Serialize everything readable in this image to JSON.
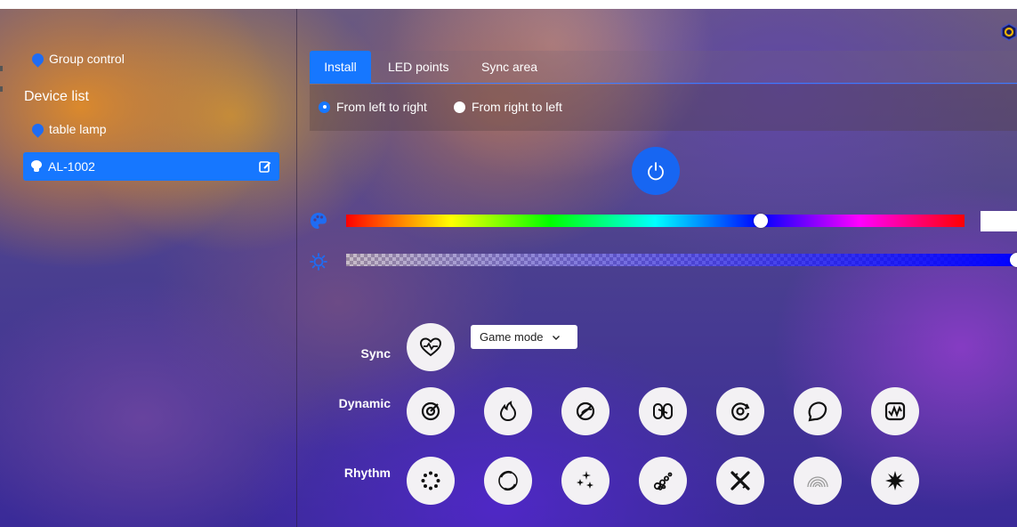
{
  "sidebar": {
    "group_control": "Group control",
    "device_list_title": "Device list",
    "devices": [
      {
        "name": "table lamp",
        "selected": false
      },
      {
        "name": "AL-1002",
        "selected": true
      }
    ]
  },
  "tabs": [
    {
      "label": "Install",
      "active": true
    },
    {
      "label": "LED points",
      "active": false
    },
    {
      "label": "Sync area",
      "active": false
    }
  ],
  "direction": {
    "options": [
      {
        "label": "From left to right",
        "checked": true
      },
      {
        "label": "From right to left",
        "checked": false
      }
    ]
  },
  "color_slider": {
    "hue_fraction": 0.67,
    "swatch_color": "#ffffff"
  },
  "brightness_slider": {
    "level_fraction": 1.0,
    "color": "#0000ff"
  },
  "modes": {
    "sync_label": "Sync",
    "sync_mode": "Game mode",
    "dynamic_label": "Dynamic",
    "rhythm_label": "Rhythm",
    "dynamic_icons": [
      "swirl-icon",
      "flame-icon",
      "orbit-icon",
      "chain-icon",
      "spiral-icon",
      "blob-icon",
      "waveform-icon"
    ],
    "rhythm_icons": [
      "dots-circle-icon",
      "ring-icon",
      "sparkles-icon",
      "bubbles-icon",
      "crossed-icon",
      "rainbow-icon",
      "burst-icon"
    ]
  },
  "colors": {
    "accent": "#1677ff",
    "power": "#1766f2",
    "settings_icon": "#f0b400"
  }
}
